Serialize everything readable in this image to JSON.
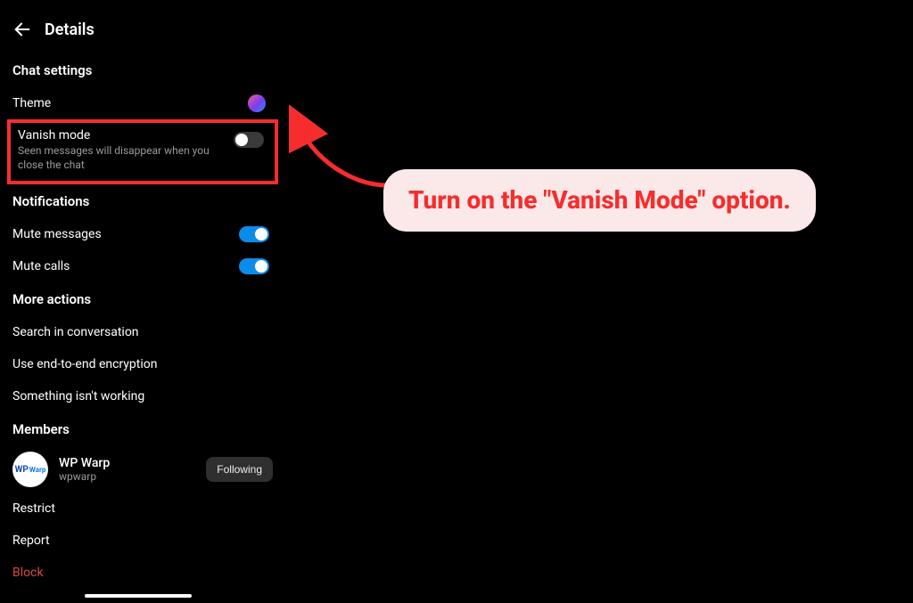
{
  "header": {
    "title": "Details"
  },
  "chatSettings": {
    "title": "Chat settings",
    "theme": {
      "label": "Theme"
    },
    "vanish": {
      "label": "Vanish mode",
      "description": "Seen messages will disappear when you close the chat"
    }
  },
  "notifications": {
    "title": "Notifications",
    "muteMessages": {
      "label": "Mute messages"
    },
    "muteCalls": {
      "label": "Mute calls"
    }
  },
  "moreActions": {
    "title": "More actions",
    "search": "Search in conversation",
    "e2ee": "Use end-to-end encryption",
    "feedback": "Something isn't working"
  },
  "members": {
    "title": "Members",
    "items": [
      {
        "name": "WP Warp",
        "handle": "wpwarp",
        "followLabel": "Following",
        "avatarText1": "WP",
        "avatarText2": "Warp"
      }
    ]
  },
  "actions": {
    "restrict": "Restrict",
    "report": "Report",
    "block": "Block"
  },
  "annotation": {
    "text": "Turn on the \"Vanish Mode\" option."
  }
}
